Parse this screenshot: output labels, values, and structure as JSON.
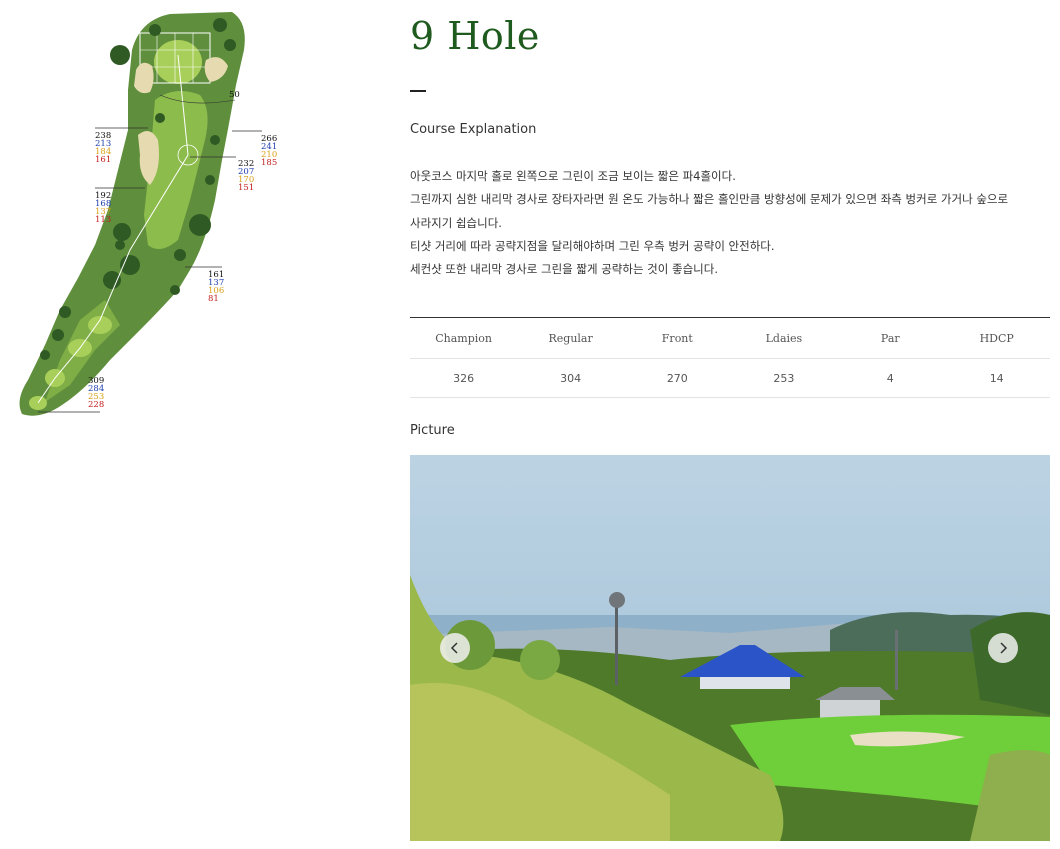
{
  "hole": {
    "title": "9 Hole"
  },
  "explanation": {
    "heading": "Course Explanation",
    "lines": [
      "아웃코스 마지막 홀로 왼쪽으로 그린이 조금 보이는 짧은 파4홀이다.",
      "그린까지 심한 내리막 경사로 장타자라면 원 온도 가능하나 짧은 홀인만큼 방향성에 문제가 있으면 좌측 벙커로 가거나 숲으로",
      "사라지기 쉽습니다.",
      "티샷 거리에 따라 공략지점을 달리해야하며 그린 우측 벙커 공략이 안전하다.",
      "세컨샷 또한 내리막 경사로 그린을 짧게 공략하는 것이 좋습니다."
    ]
  },
  "scorecard": {
    "headers": [
      "Champion",
      "Regular",
      "Front",
      "Ldaies",
      "Par",
      "HDCP"
    ],
    "values": [
      "326",
      "304",
      "270",
      "253",
      "4",
      "14"
    ]
  },
  "picture": {
    "heading": "Picture",
    "prev_icon": "chevron-left-icon",
    "next_icon": "chevron-right-icon"
  },
  "map": {
    "marker_top": "50",
    "yardages": [
      {
        "id": "left1",
        "values": [
          "238",
          "213",
          "184",
          "161"
        ]
      },
      {
        "id": "right1",
        "values": [
          "266",
          "241",
          "210",
          "185"
        ]
      },
      {
        "id": "center",
        "values": [
          "232",
          "207",
          "170",
          "151"
        ]
      },
      {
        "id": "left2",
        "values": [
          "192",
          "168",
          "137",
          "113"
        ]
      },
      {
        "id": "right2",
        "values": [
          "161",
          "137",
          "106",
          "81"
        ]
      },
      {
        "id": "tee",
        "values": [
          "309",
          "284",
          "253",
          "228"
        ]
      }
    ],
    "colors": [
      "#111111",
      "#1f3fb0",
      "#d9a018",
      "#c42020"
    ]
  }
}
